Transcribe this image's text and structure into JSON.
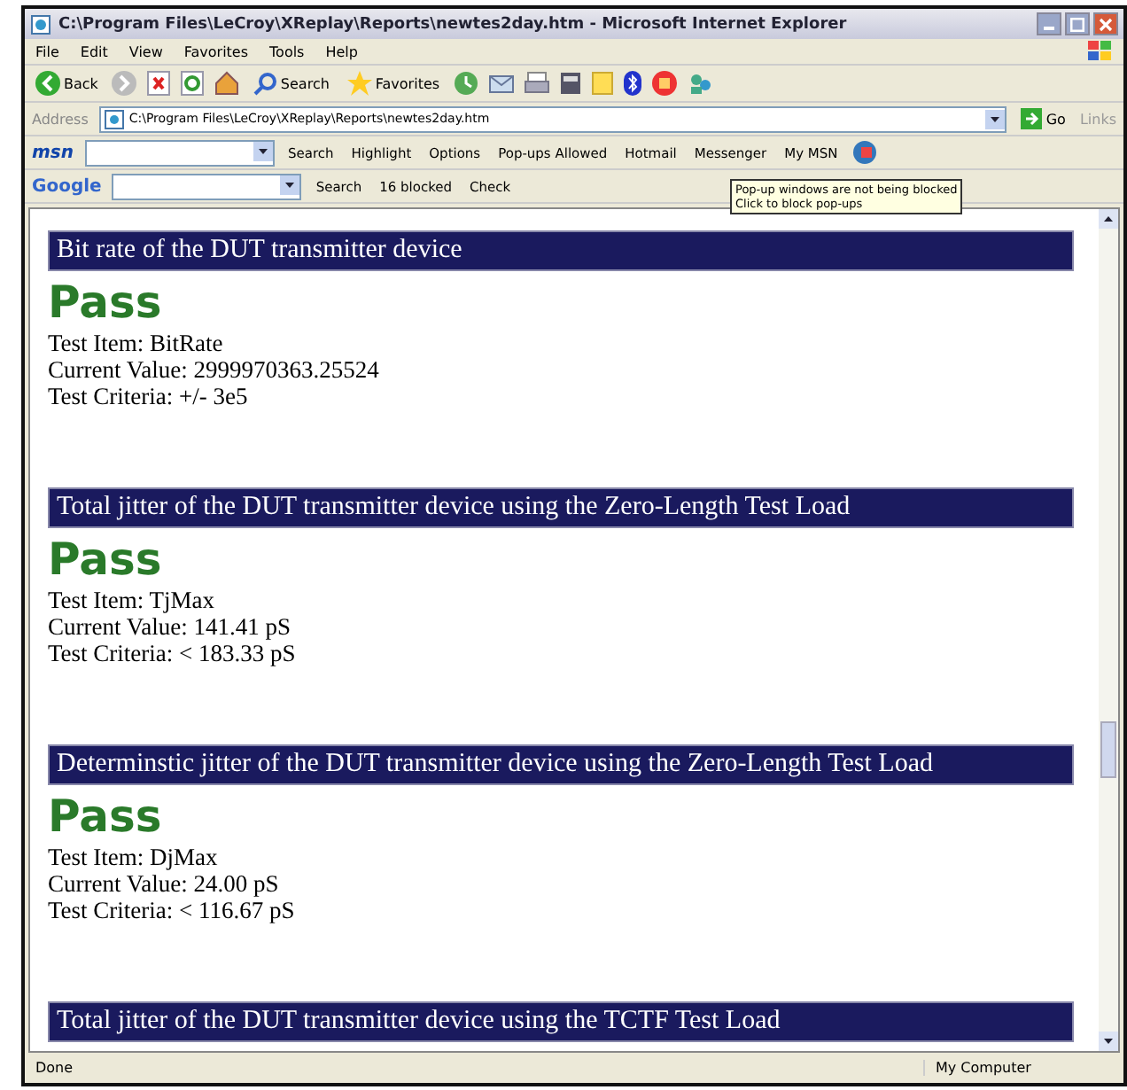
{
  "window": {
    "title": "C:\\Program Files\\LeCroy\\XReplay\\Reports\\newtes2day.htm - Microsoft Internet Explorer"
  },
  "menu": [
    "File",
    "Edit",
    "View",
    "Favorites",
    "Tools",
    "Help"
  ],
  "toolbar": {
    "back": "Back",
    "search": "Search",
    "favorites": "Favorites"
  },
  "address": {
    "label": "Address",
    "url": "C:\\Program Files\\LeCroy\\XReplay\\Reports\\newtes2day.htm",
    "go": "Go",
    "links": "Links"
  },
  "msn_toolbar": {
    "logo": "msn",
    "items": [
      "Search",
      "Highlight",
      "Options",
      "Pop-ups Allowed",
      "Hotmail",
      "Messenger",
      "My MSN"
    ]
  },
  "google_toolbar": {
    "logo": "Google",
    "items": [
      "Search",
      "16 blocked",
      "Check"
    ]
  },
  "tooltip": {
    "lines": [
      "Pop-up windows are not being blocked",
      "Click to block pop-ups"
    ]
  },
  "sections": [
    {
      "heading": "Bit rate of the DUT transmitter device",
      "result": "Pass",
      "lines": [
        "Test Item: BitRate",
        "Current Value: 2999970363.25524",
        "Test Criteria: +/- 3e5"
      ]
    },
    {
      "heading": "Total jitter of the DUT transmitter device using the Zero-Length Test Load",
      "result": "Pass",
      "lines": [
        "Test Item: TjMax",
        "Current Value: 141.41 pS",
        "Test Criteria: < 183.33 pS"
      ]
    },
    {
      "heading": "Determinstic jitter of the DUT transmitter device using the Zero-Length Test Load",
      "result": "Pass",
      "lines": [
        "Test Item: DjMax",
        "Current Value: 24.00 pS",
        "Test Criteria: < 116.67 pS"
      ]
    },
    {
      "heading": "Total jitter of the DUT transmitter device using the TCTF Test Load"
    }
  ],
  "status_bar": {
    "text": "Done",
    "zone": "My Computer"
  }
}
